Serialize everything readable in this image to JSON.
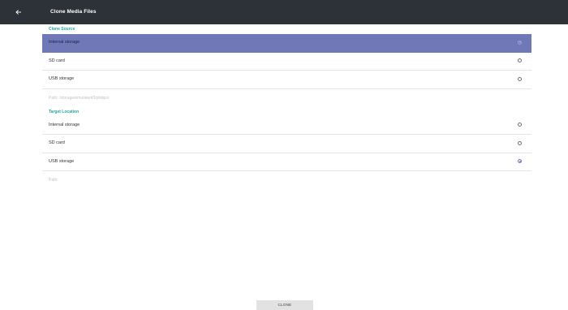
{
  "toolbar": {
    "title": "Clone Media Files",
    "back_icon": "arrow-left-icon"
  },
  "source": {
    "header": "Clone Source",
    "options": [
      {
        "label": "Internal storage",
        "selected": true
      },
      {
        "label": "SD card",
        "selected": false
      },
      {
        "label": "USB storage",
        "selected": false
      }
    ],
    "path": "Path: /storage/emulated/0/philips/"
  },
  "target": {
    "header": "Target Location",
    "options": [
      {
        "label": "Internal storage",
        "selected": false
      },
      {
        "label": "SD card",
        "selected": false
      },
      {
        "label": "USB storage",
        "selected": true
      }
    ],
    "path": "Path:"
  },
  "footer": {
    "clone_label": "CLONE"
  },
  "colors": {
    "toolbar": "#2d3238",
    "accent": "#26a69a",
    "selection": "#7178b8"
  }
}
